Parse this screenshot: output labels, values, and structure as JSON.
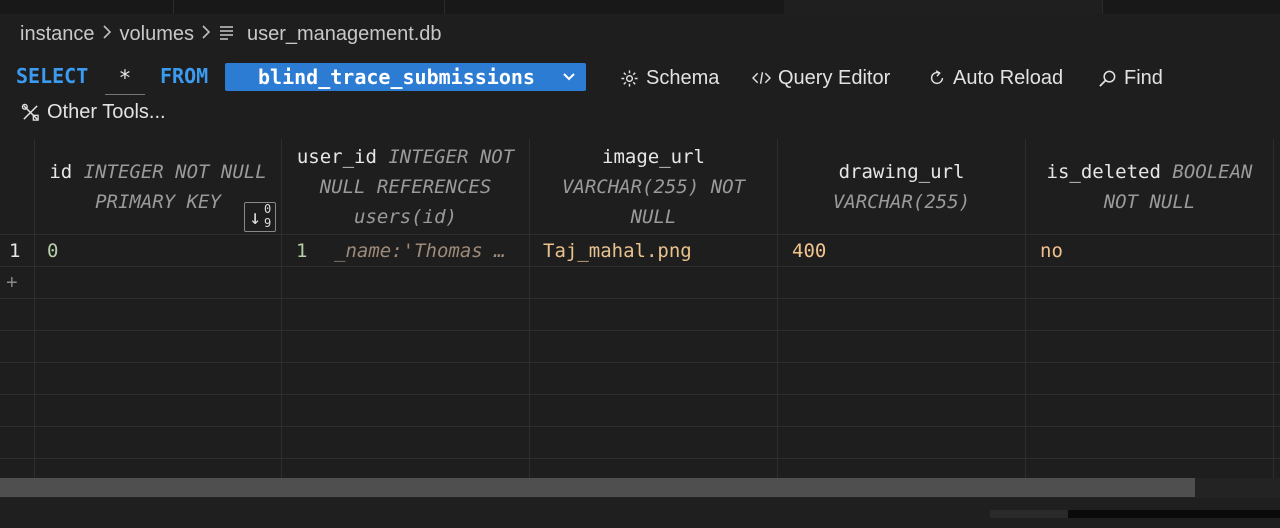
{
  "breadcrumb": {
    "part1": "instance",
    "part2": "volumes",
    "file": "user_management.db"
  },
  "query": {
    "select_kw": "SELECT",
    "star": "*",
    "from_kw": "FROM",
    "table": "blind_trace_submissions"
  },
  "tools": {
    "schema": "Schema",
    "query_editor": "Query Editor",
    "auto_reload": "Auto Reload",
    "find": "Find",
    "other_tools": "Other Tools..."
  },
  "columns": [
    {
      "name": "id",
      "type_line1": "INTEGER NOT NULL",
      "type_line2": "PRIMARY KEY"
    },
    {
      "name": "user_id",
      "type_line1": "INTEGER NOT",
      "type_line2": "NULL REFERENCES",
      "type_line3": "users(id)"
    },
    {
      "name": "image_url",
      "type_line1": "VARCHAR(255) NOT",
      "type_line2": "NULL"
    },
    {
      "name": "drawing_url",
      "type_line1": "VARCHAR(255)"
    },
    {
      "name": "is_deleted",
      "type_line1": "BOOLEAN",
      "type_line2": "NOT NULL"
    }
  ],
  "rows": [
    {
      "row_num": "1",
      "id": "0",
      "user_id": "1",
      "user_ref": "_name:'Thomas …",
      "image_url": "Taj_mahal.png",
      "drawing_url": "400",
      "is_deleted": "no"
    }
  ],
  "add_row": "+",
  "sort": {
    "top": "0",
    "bottom": "9"
  },
  "colors": {
    "keyword": "#3b9bf0",
    "number": "#b5cea8",
    "string": "#ce9178",
    "select_bg": "#2d7cd4"
  }
}
